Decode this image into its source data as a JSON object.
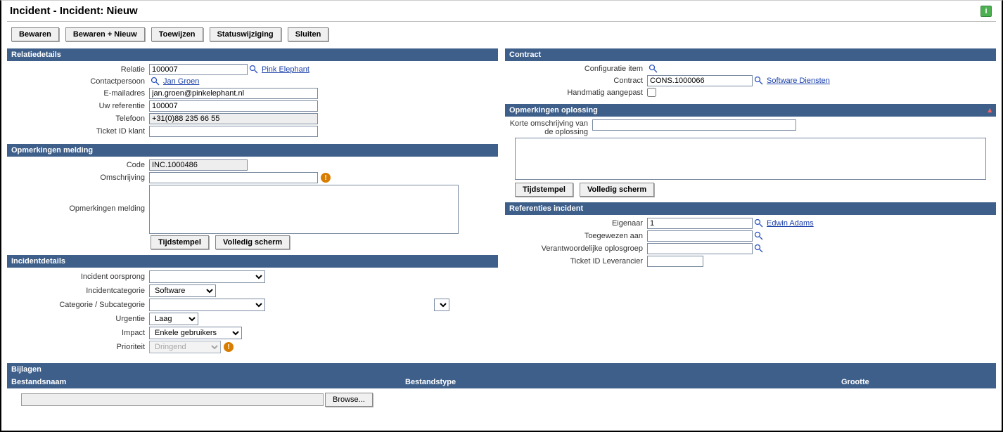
{
  "title": "Incident - Incident: Nieuw",
  "toolbar": {
    "bewaren": "Bewaren",
    "bewaren_nieuw": "Bewaren + Nieuw",
    "toewijzen": "Toewijzen",
    "statuswijziging": "Statuswijziging",
    "sluiten": "Sluiten"
  },
  "relatiedetails": {
    "header": "Relatiedetails",
    "relatie_lbl": "Relatie",
    "relatie_val": "100007",
    "relatie_link": "Pink Elephant",
    "contact_lbl": "Contactpersoon",
    "contact_link": "Jan Groen",
    "email_lbl": "E-mailadres",
    "email_val": "jan.groen@pinkelephant.nl",
    "uwref_lbl": "Uw referentie",
    "uwref_val": "100007",
    "tel_lbl": "Telefoon",
    "tel_val": "+31(0)88 235 66 55",
    "ticket_lbl": "Ticket ID klant",
    "ticket_val": ""
  },
  "opm_melding": {
    "header": "Opmerkingen melding",
    "code_lbl": "Code",
    "code_val": "INC.1000486",
    "omschr_lbl": "Omschrijving",
    "omschr_val": "",
    "opm_lbl": "Opmerkingen melding",
    "tijdstempel": "Tijdstempel",
    "volledig": "Volledig scherm"
  },
  "incidentdetails": {
    "header": "Incidentdetails",
    "oorsprong_lbl": "Incident oorsprong",
    "oorsprong_val": "",
    "cat_lbl": "Incidentcategorie",
    "cat_val": "Software",
    "subcat_lbl": "Categorie / Subcategorie",
    "urg_lbl": "Urgentie",
    "urg_val": "Laag",
    "impact_lbl": "Impact",
    "impact_val": "Enkele gebruikers",
    "prio_lbl": "Prioriteit",
    "prio_val": "Dringend"
  },
  "contract": {
    "header": "Contract",
    "ci_lbl": "Configuratie item",
    "contract_lbl": "Contract",
    "contract_val": "CONS.1000066",
    "contract_link": "Software Diensten",
    "handmatig_lbl": "Handmatig aangepast"
  },
  "opm_oplossing": {
    "header": "Opmerkingen oplossing",
    "korte_lbl_l1": "Korte omschrijving van",
    "korte_lbl_l2": "de oplossing",
    "tijdstempel": "Tijdstempel",
    "volledig": "Volledig scherm"
  },
  "referenties": {
    "header": "Referenties incident",
    "eigenaar_lbl": "Eigenaar",
    "eigenaar_val": "1",
    "eigenaar_link": "Edwin Adams",
    "toeg_lbl": "Toegewezen aan",
    "verantw_lbl": "Verantwoordelijke oplosgroep",
    "ticketlev_lbl": "Ticket ID Leverancier"
  },
  "bijlagen": {
    "header": "Bijlagen",
    "col1": "Bestandsnaam",
    "col2": "Bestandstype",
    "col3": "Grootte",
    "browse": "Browse..."
  }
}
